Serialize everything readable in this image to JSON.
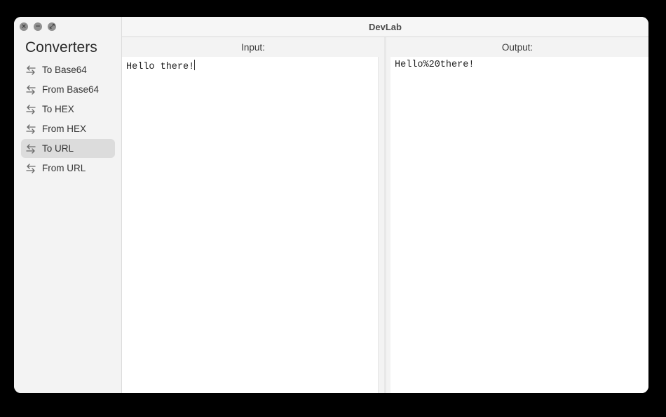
{
  "window": {
    "title": "DevLab"
  },
  "sidebar": {
    "title": "Converters",
    "items": [
      {
        "label": "To Base64",
        "active": false
      },
      {
        "label": "From Base64",
        "active": false
      },
      {
        "label": "To HEX",
        "active": false
      },
      {
        "label": "From HEX",
        "active": false
      },
      {
        "label": "To URL",
        "active": true
      },
      {
        "label": "From URL",
        "active": false
      }
    ],
    "item_icon": "arrows-swap-icon"
  },
  "input": {
    "label": "Input:",
    "value": "Hello there!"
  },
  "output": {
    "label": "Output:",
    "value": "Hello%20there!"
  },
  "colors": {
    "sidebar_bg": "#f3f3f3",
    "active_item_bg": "#dcdcdc",
    "background": "#000000"
  }
}
